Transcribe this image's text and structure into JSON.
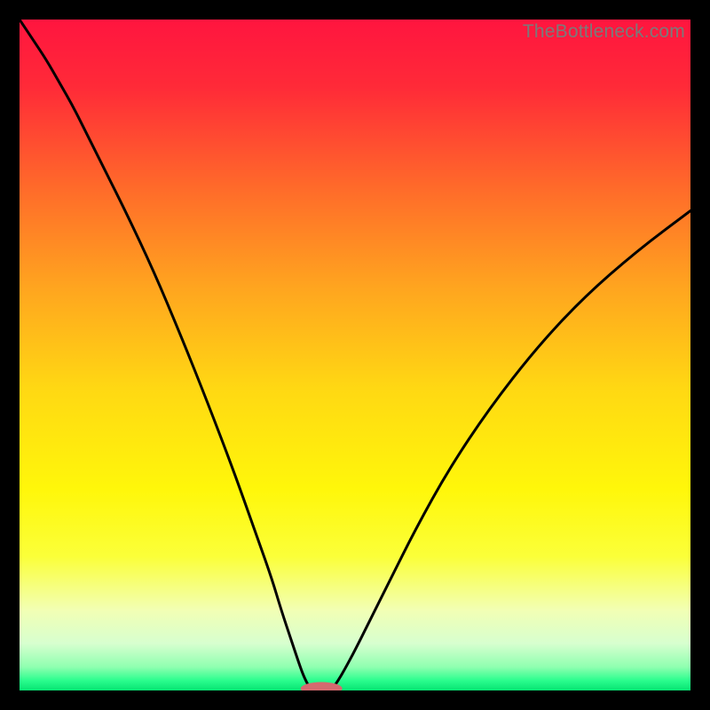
{
  "watermark": "TheBottleneck.com",
  "chart_data": {
    "type": "line",
    "title": "",
    "xlabel": "",
    "ylabel": "",
    "xlim": [
      0,
      100
    ],
    "ylim": [
      0,
      100
    ],
    "gradient_stops": [
      {
        "offset": 0.0,
        "color": "#ff153f"
      },
      {
        "offset": 0.1,
        "color": "#ff2a38"
      },
      {
        "offset": 0.25,
        "color": "#ff6a2a"
      },
      {
        "offset": 0.4,
        "color": "#ffa51f"
      },
      {
        "offset": 0.55,
        "color": "#ffd813"
      },
      {
        "offset": 0.7,
        "color": "#fff70a"
      },
      {
        "offset": 0.8,
        "color": "#fbff39"
      },
      {
        "offset": 0.88,
        "color": "#f2ffb4"
      },
      {
        "offset": 0.93,
        "color": "#d7ffcf"
      },
      {
        "offset": 0.965,
        "color": "#8fffb0"
      },
      {
        "offset": 0.985,
        "color": "#2bfd8e"
      },
      {
        "offset": 1.0,
        "color": "#06e472"
      }
    ],
    "series": [
      {
        "name": "left-curve",
        "x": [
          0,
          2,
          4,
          6,
          8,
          10,
          13,
          16,
          20,
          24,
          28,
          32,
          35,
          37.5,
          39,
          40.5,
          41.5,
          42.2,
          42.8,
          43.2
        ],
        "y": [
          100,
          97,
          94,
          90.5,
          87,
          83,
          77,
          71,
          62.5,
          53,
          43,
          32.5,
          24,
          17,
          12,
          7.5,
          4.5,
          2.5,
          1.2,
          0.5
        ]
      },
      {
        "name": "right-curve",
        "x": [
          46.8,
          47.5,
          48.5,
          50,
          52,
          55,
          59,
          64,
          70,
          77,
          84,
          92,
          100
        ],
        "y": [
          0.5,
          1.5,
          3.2,
          6,
          10,
          16,
          24,
          33,
          42,
          51,
          58.5,
          65.5,
          71.5
        ]
      }
    ],
    "marker": {
      "name": "bottom-marker",
      "cx": 45,
      "cy": 0.3,
      "rx_percent": 3.1,
      "ry_percent": 0.95,
      "fill": "#d46a6f"
    }
  }
}
